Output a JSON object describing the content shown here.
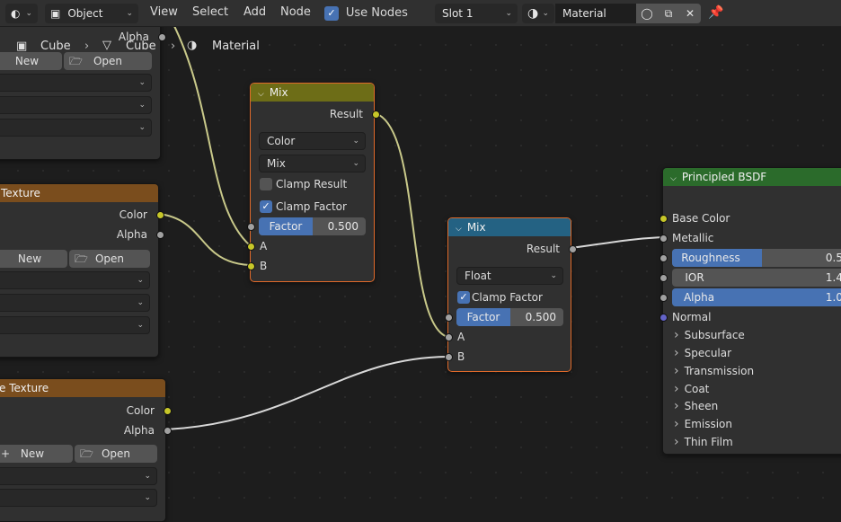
{
  "header": {
    "mode": "Object",
    "menus": [
      "View",
      "Select",
      "Add",
      "Node"
    ],
    "use_nodes": "Use Nodes",
    "slot": "Slot 1",
    "material": "Material"
  },
  "breadcrumb": [
    "Cube",
    "Cube",
    "Material"
  ],
  "left_panel_top": {
    "alpha": "Alpha",
    "new": "New",
    "open": "Open"
  },
  "texture_node_1": {
    "title": "Texture",
    "color": "Color",
    "alpha": "Alpha",
    "new": "New",
    "open": "Open"
  },
  "texture_node_2": {
    "title": "e Texture",
    "color": "Color",
    "alpha": "Alpha",
    "new": "New",
    "open": "Open"
  },
  "mix_color": {
    "title": "Mix",
    "result": "Result",
    "data_type": "Color",
    "blend": "Mix",
    "clamp_result": "Clamp Result",
    "clamp_factor": "Clamp Factor",
    "factor_label": "Factor",
    "factor_value": "0.500",
    "factor": 0.5,
    "a": "A",
    "b": "B"
  },
  "mix_float": {
    "title": "Mix",
    "result": "Result",
    "data_type": "Float",
    "clamp_factor": "Clamp Factor",
    "factor_label": "Factor",
    "factor_value": "0.500",
    "factor": 0.5,
    "a": "A",
    "b": "B"
  },
  "bsdf": {
    "title": "Principled BSDF",
    "base_color": "Base Color",
    "metallic": "Metallic",
    "roughness_label": "Roughness",
    "roughness_value": "0.5",
    "roughness": 0.5,
    "ior_label": "IOR",
    "ior_value": "1.4",
    "alpha_label": "Alpha",
    "alpha_value": "1.0",
    "alpha": 1.0,
    "normal": "Normal",
    "panels": [
      "Subsurface",
      "Specular",
      "Transmission",
      "Coat",
      "Sheen",
      "Emission",
      "Thin Film"
    ]
  },
  "colors": {
    "accent": "#4772b3",
    "color_socket": "#c7c729",
    "float_socket": "#a1a1a1",
    "vector_socket": "#6363c7",
    "mix_color_header": "#6d6d17",
    "mix_float_header": "#246283",
    "texture_header": "#7a4d1d",
    "bsdf_header": "#2b6b2b",
    "selected_outline": "#e06a2a"
  }
}
